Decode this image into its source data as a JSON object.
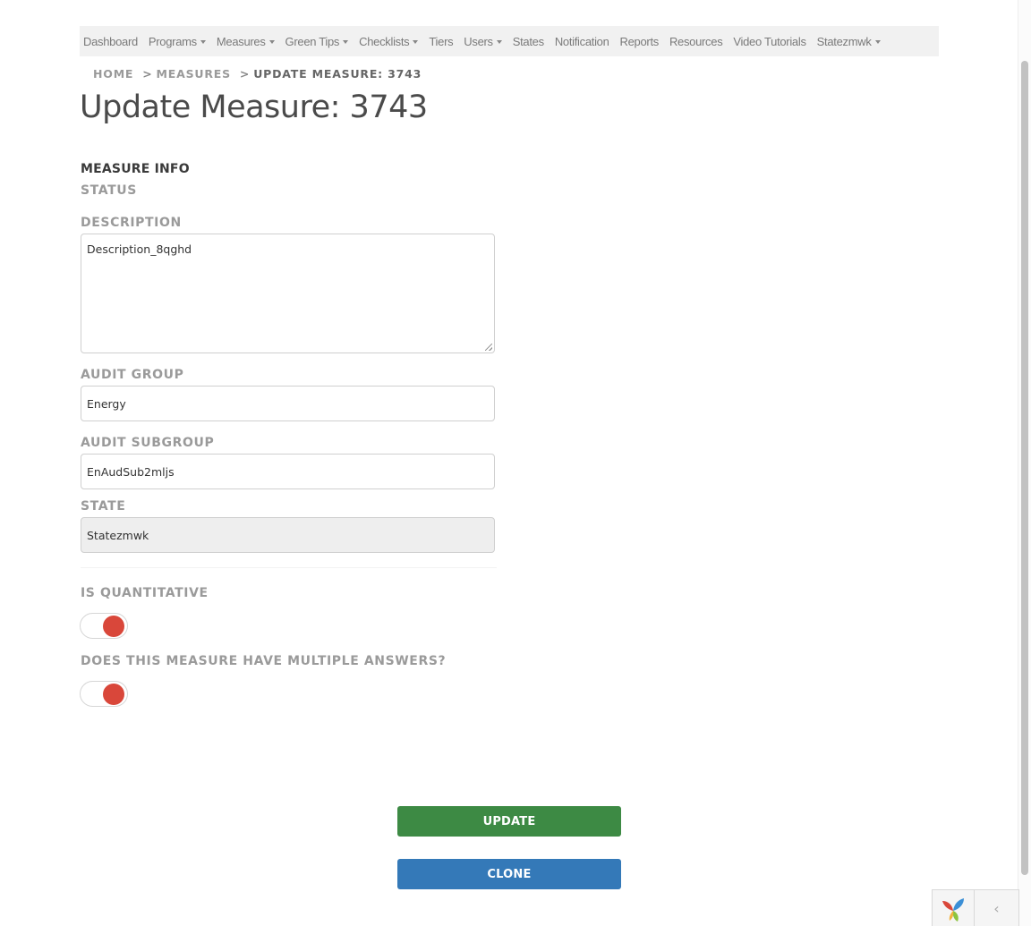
{
  "nav": {
    "items": [
      {
        "label": "Dashboard",
        "dropdown": false
      },
      {
        "label": "Programs",
        "dropdown": true
      },
      {
        "label": "Measures",
        "dropdown": true
      },
      {
        "label": "Green Tips",
        "dropdown": true
      },
      {
        "label": "Checklists",
        "dropdown": true
      },
      {
        "label": "Tiers",
        "dropdown": false
      },
      {
        "label": "Users",
        "dropdown": true
      },
      {
        "label": "States",
        "dropdown": false
      },
      {
        "label": "Notification",
        "dropdown": false
      },
      {
        "label": "Reports",
        "dropdown": false
      },
      {
        "label": "Resources",
        "dropdown": false
      },
      {
        "label": "Video Tutorials",
        "dropdown": false
      },
      {
        "label": "Statezmwk",
        "dropdown": true
      }
    ]
  },
  "breadcrumb": {
    "home": "HOME",
    "sep1": ">",
    "measures": "MEASURES",
    "sep2": ">",
    "current": "UPDATE MEASURE: 3743"
  },
  "page_title": "Update Measure: 3743",
  "form": {
    "section_title": "MEASURE INFO",
    "status_label": "STATUS",
    "description_label": "DESCRIPTION",
    "description_value": "Description_8qghd",
    "audit_group_label": "AUDIT GROUP",
    "audit_group_value": "Energy",
    "audit_subgroup_label": "AUDIT SUBGROUP",
    "audit_subgroup_value": "EnAudSub2mljs",
    "state_label": "STATE",
    "state_value": "Statezmwk",
    "is_quantitative_label": "IS QUANTITATIVE",
    "is_quantitative_on": true,
    "multiple_answers_label": "DOES THIS MEASURE HAVE MULTIPLE ANSWERS?",
    "multiple_answers_on": true
  },
  "buttons": {
    "update": "UPDATE",
    "clone": "CLONE"
  },
  "debug_toolbar": {
    "toggle_glyph": "‹"
  },
  "colors": {
    "update_button": "#3d8a44",
    "clone_button": "#3479b8",
    "toggle_knob": "#d9473a",
    "navbar_bg": "#f1f1f1"
  }
}
